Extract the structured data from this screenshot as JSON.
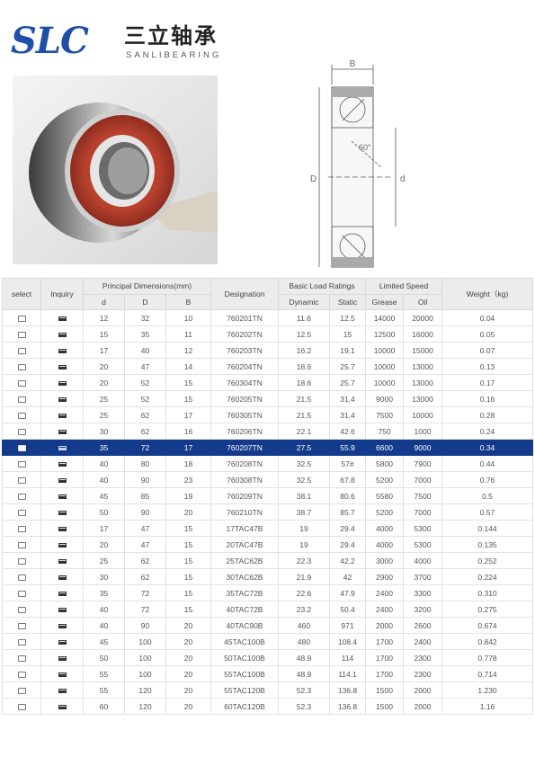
{
  "brand": {
    "mark": "SLC",
    "name_cn": "三立轴承",
    "name_en": "SANLIBEARING",
    "color": "#1f4fa8"
  },
  "drawing": {
    "b_label": "B",
    "D_label": "D",
    "d_label": "d",
    "angle_label": "60°"
  },
  "table": {
    "headers": {
      "select": "select",
      "inquiry": "Inquiry",
      "dims": "Principal Dimensions(mm)",
      "d": "d",
      "D": "D",
      "B": "B",
      "designation": "Designation",
      "load": "Basic Load Ratings",
      "dynamic": "Dynamic",
      "static": "Static",
      "speed": "Limited Speed",
      "grease": "Grease",
      "oil": "Oil",
      "weight": "Weight（kg)"
    },
    "highlight_color": "#143a8c",
    "selected_row": 8,
    "rows": [
      [
        "12",
        "32",
        "10",
        "760201TN",
        "11.6",
        "12.5",
        "14000",
        "20000",
        "0.04"
      ],
      [
        "15",
        "35",
        "11",
        "760202TN",
        "12.5",
        "15",
        "12500",
        "16000",
        "0.05"
      ],
      [
        "17",
        "40",
        "12",
        "760203TN",
        "16.2",
        "19.1",
        "10000",
        "15000",
        "0.07"
      ],
      [
        "20",
        "47",
        "14",
        "760204TN",
        "18.6",
        "25.7",
        "10000",
        "13000",
        "0.13"
      ],
      [
        "20",
        "52",
        "15",
        "760304TN",
        "18.6",
        "25.7",
        "10000",
        "13000",
        "0.17"
      ],
      [
        "25",
        "52",
        "15",
        "760205TN",
        "21.5",
        "31.4",
        "9000",
        "13000",
        "0.16"
      ],
      [
        "25",
        "62",
        "17",
        "760305TN",
        "21.5",
        "31.4",
        "7500",
        "10000",
        "0.28"
      ],
      [
        "30",
        "62",
        "16",
        "760206TN",
        "22.1",
        "42.6",
        "750",
        "1000",
        "0.24"
      ],
      [
        "35",
        "72",
        "17",
        "760207TN",
        "27.5",
        "55.9",
        "6600",
        "9000",
        "0.34"
      ],
      [
        "40",
        "80",
        "18",
        "760208TN",
        "32.5",
        "57#",
        "5800",
        "7900",
        "0.44"
      ],
      [
        "40",
        "90",
        "23",
        "760308TN",
        "32.5",
        "67.8",
        "5200",
        "7000",
        "0.76"
      ],
      [
        "45",
        "85",
        "19",
        "760209TN",
        "38.1",
        "80.6",
        "5580",
        "7500",
        "0.5"
      ],
      [
        "50",
        "90",
        "20",
        "760210TN",
        "38.7",
        "85.7",
        "5200",
        "7000",
        "0.57"
      ],
      [
        "17",
        "47",
        "15",
        "17TAC47B",
        "19",
        "29.4",
        "4000",
        "5300",
        "0.144"
      ],
      [
        "20",
        "47",
        "15",
        "20TAC47B",
        "19",
        "29.4",
        "4000",
        "5300",
        "0.135"
      ],
      [
        "25",
        "62",
        "15",
        "25TAC62B",
        "22.3",
        "42.2",
        "3000",
        "4000",
        "0.252"
      ],
      [
        "30",
        "62",
        "15",
        "30TAC62B",
        "21.9",
        "42",
        "2900",
        "3700",
        "0.224"
      ],
      [
        "35",
        "72",
        "15",
        "35TAC72B",
        "22.6",
        "47.9",
        "2400",
        "3300",
        "0.310"
      ],
      [
        "40",
        "72",
        "15",
        "40TAC72B",
        "23.2",
        "50.4",
        "2400",
        "3200",
        "0.275"
      ],
      [
        "40",
        "90",
        "20",
        "40TAC90B",
        "460",
        "971",
        "2000",
        "2600",
        "0.674"
      ],
      [
        "45",
        "100",
        "20",
        "45TAC100B",
        "480",
        "108.4",
        "1700",
        "2400",
        "0.842"
      ],
      [
        "50",
        "100",
        "20",
        "50TAC100B",
        "48.9",
        "114",
        "1700",
        "2300",
        "0.778"
      ],
      [
        "55",
        "100",
        "20",
        "55TAC100B",
        "48.9",
        "114.1",
        "1700",
        "2300",
        "0.714"
      ],
      [
        "55",
        "120",
        "20",
        "55TAC120B",
        "52.3",
        "136.8",
        "1500",
        "2000",
        "1.230"
      ],
      [
        "60",
        "120",
        "20",
        "60TAC120B",
        "52.3",
        "136.8",
        "1500",
        "2000",
        "1.16"
      ]
    ]
  }
}
